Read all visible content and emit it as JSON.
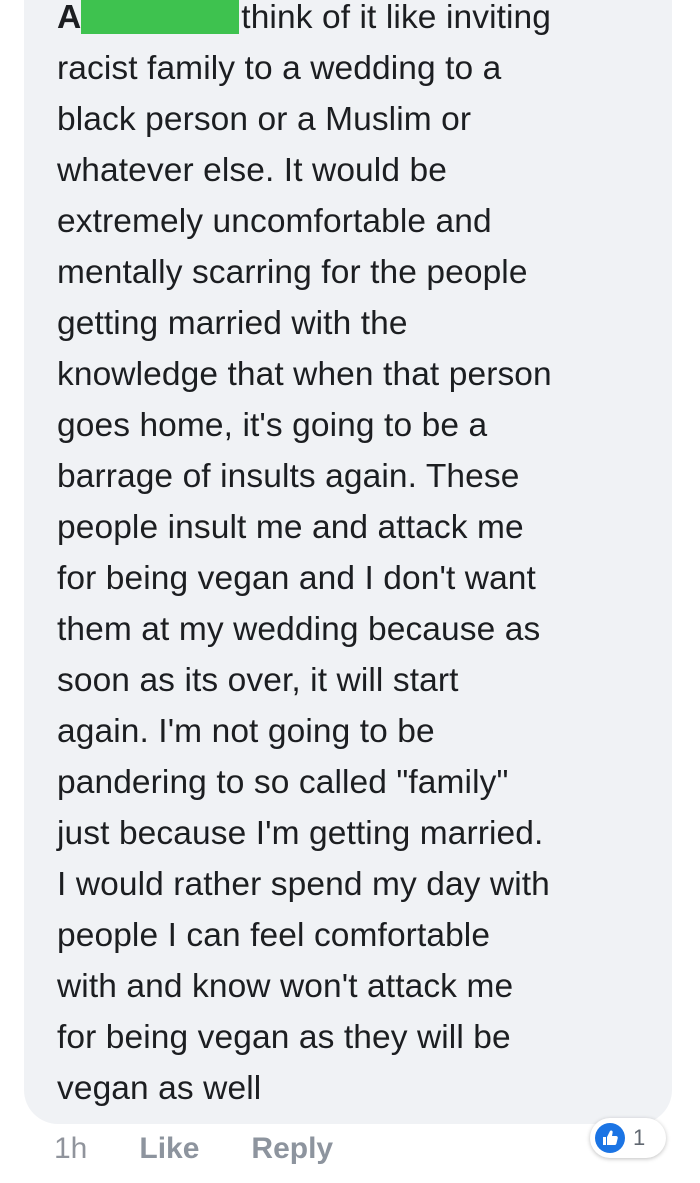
{
  "comment": {
    "author_visible": "A",
    "lines": [
      "think of it like inviting",
      "racist family to a wedding to a",
      "black person or a Muslim or",
      "whatever else. It would be",
      "extremely uncomfortable and",
      "mentally scarring for the people",
      "getting married with the",
      "knowledge that when that person",
      "goes home, it's going to be a",
      "barrage of insults again. These",
      "people insult me and attack me",
      "for being vegan and I don't want",
      "them at my wedding because as",
      "soon as its over, it will start",
      "again. I'm not going to be",
      "pandering to so called \"family\"",
      "just because I'm getting married.",
      "I would rather spend my day with",
      "people I can feel comfortable",
      "with and know won't attack me",
      "for being vegan as they will be",
      "vegan as well"
    ]
  },
  "actions": {
    "time": "1h",
    "like_label": "Like",
    "reply_label": "Reply"
  },
  "reactions": {
    "icon": "thumbs-up-icon",
    "count": "1"
  },
  "colors": {
    "bubble": "#f0f2f5",
    "text": "#1c1e21",
    "meta": "#90949c",
    "like_blue": "#1b74e4",
    "redaction": "#3ec24f"
  }
}
